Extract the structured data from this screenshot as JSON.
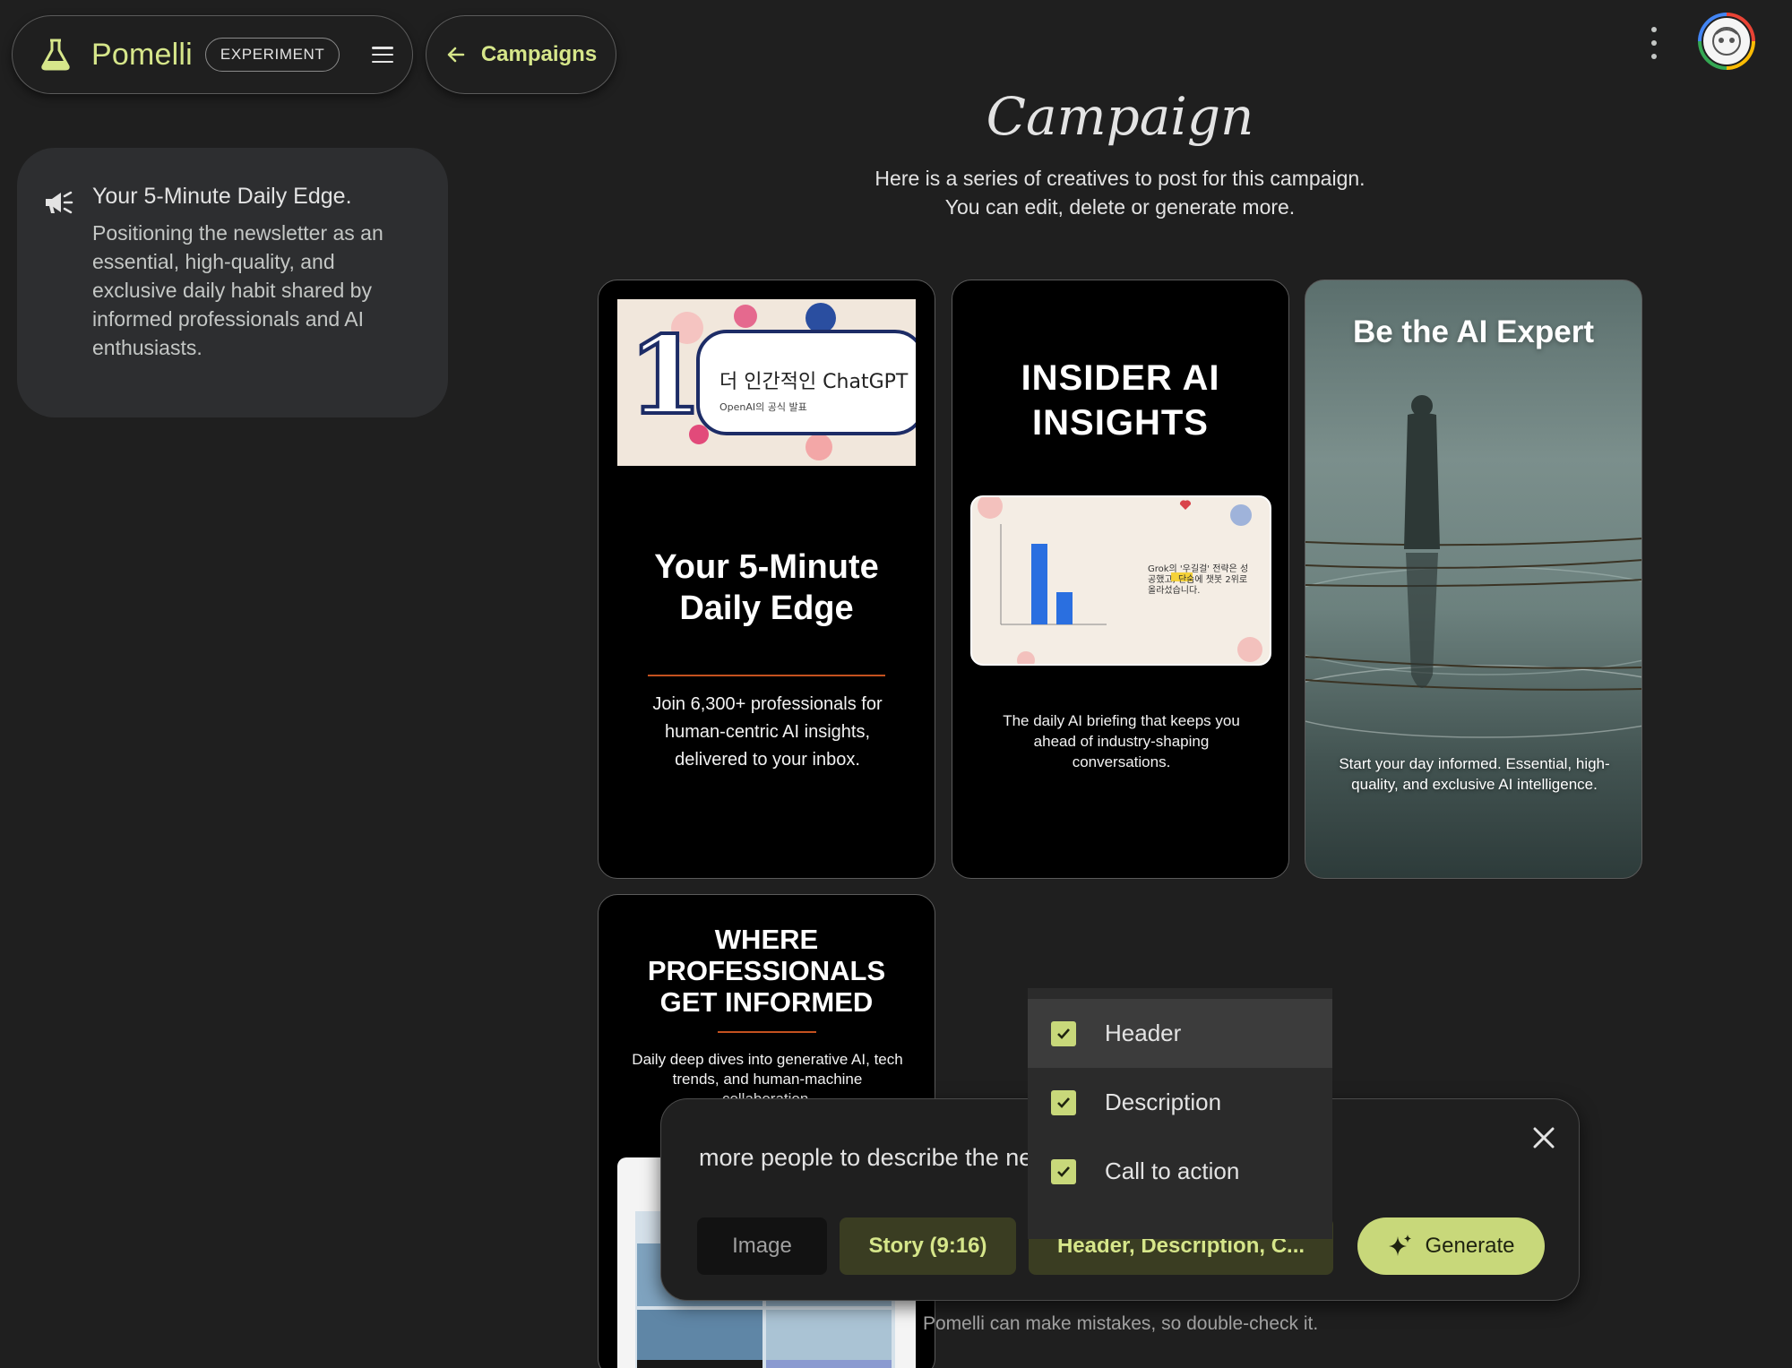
{
  "brand": {
    "name": "Pomelli",
    "badge": "EXPERIMENT",
    "accent": "#d6e68a"
  },
  "nav": {
    "back_label": "Campaigns"
  },
  "theme": {
    "title": "Your 5-Minute Daily Edge.",
    "description": "Positioning the newsletter as an essential, high-quality, and exclusive daily habit shared by informed professionals and AI enthusiasts."
  },
  "page": {
    "title": "Campaign",
    "subtitle_line1": "Here is a series of creatives to post for this campaign.",
    "subtitle_line2": "You can edit, delete or generate more."
  },
  "creatives": [
    {
      "thumb_title": "더 인간적인 ChatGPT",
      "thumb_sub": "OpenAI의 공식 발표",
      "thumb_number": "1",
      "header_line1": "Your 5-Minute",
      "header_line2": "Daily Edge",
      "body": "Join 6,300+ professionals for human-centric AI insights, delivered to your inbox."
    },
    {
      "header_line1": "INSIDER AI",
      "header_line2": "INSIGHTS",
      "thumb_note": "Grok의 '우길걸' 전략은 성공했고, 단숨에 챗봇 2위로 올라섰습니다.",
      "body": "The daily AI briefing that keeps you ahead of industry-shaping conversations."
    },
    {
      "header": "Be the AI Expert",
      "body": "Start your day informed. Essential, high-quality, and exclusive AI intelligence."
    },
    {
      "header_line1": "WHERE",
      "header_line2": "PROFESSIONALS",
      "header_line3": "GET INFORMED",
      "body": "Daily deep dives into generative AI, tech trends, and human-machine collaboration."
    }
  ],
  "prompt": {
    "text": "more people to describe the newsletter",
    "chip_image": "Image",
    "chip_story": "Story (9:16)",
    "chip_fields": "Header, Description, C...",
    "generate": "Generate"
  },
  "dropdown": {
    "items": [
      {
        "label": "Header",
        "checked": true
      },
      {
        "label": "Description",
        "checked": true
      },
      {
        "label": "Call to action",
        "checked": true
      }
    ]
  },
  "disclaimer": "Pomelli can make mistakes, so double-check it."
}
